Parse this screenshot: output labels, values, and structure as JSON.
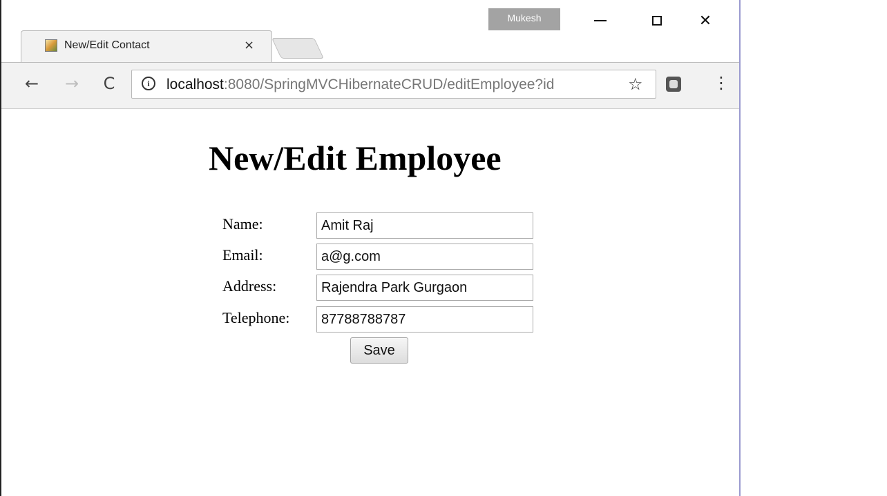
{
  "window": {
    "profile_name": "Mukesh",
    "minimize_glyph": "",
    "close_glyph": "✕"
  },
  "tab": {
    "title": "New/Edit Contact",
    "close_glyph": "×"
  },
  "toolbar": {
    "back_glyph": "←",
    "forward_glyph": "→",
    "reload_glyph": "C",
    "info_glyph": "i",
    "url_host": "localhost",
    "url_path": ":8080/SpringMVCHibernateCRUD/editEmployee?id",
    "star_glyph": "☆",
    "menu_glyph": "⋮"
  },
  "page": {
    "heading": "New/Edit Employee",
    "fields": [
      {
        "label": "Name:",
        "value": "Amit Raj"
      },
      {
        "label": "Email:",
        "value": "a@g.com"
      },
      {
        "label": "Address:",
        "value": "Rajendra Park Gurgaon"
      },
      {
        "label": "Telephone:",
        "value": "87788788787"
      }
    ],
    "save_label": "Save"
  },
  "colors": {
    "profile_badge": "#a3a3a3",
    "toolbar_bg": "#f2f2f2",
    "right_border": "#9a9ad0"
  }
}
